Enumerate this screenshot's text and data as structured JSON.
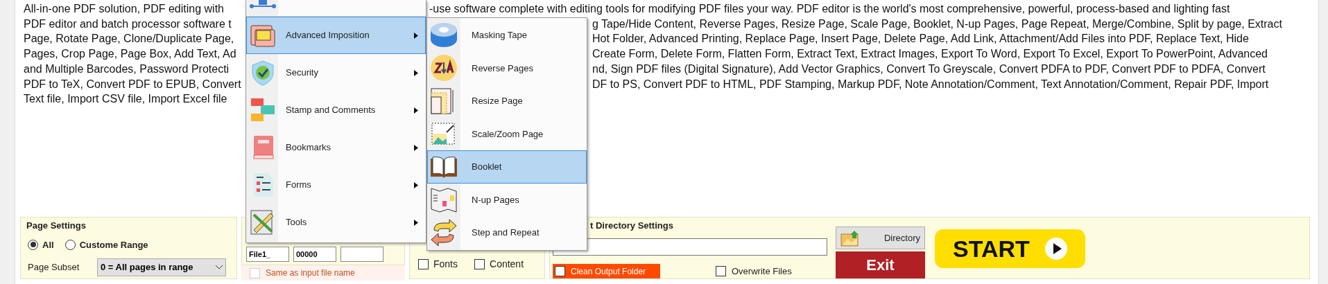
{
  "description_lines": [
    {
      "left": "All-in-one PDF solution, PDF editing with",
      "right": "-use software complete with editing tools for modifying PDF files your way. PDF editor is the world's most comprehensive, powerful, process-based and lighting fast"
    },
    {
      "left": "PDF editor and batch processor software t",
      "right": "g Tape/Hide Content, Reverse Pages, Resize Page, Scale Page, Booklet, N-up Pages, Page Repeat, Merge/Combine, Split by page, Extract"
    },
    {
      "left": "Page, Rotate Page, Clone/Duplicate Page,",
      "right": "Hot Folder, Advanced Printing, Replace Page, Insert Page, Delete Page, Add Link, Attachment/Add Files into PDF, Replace Text, Hide"
    },
    {
      "left": "Pages, Crop Page, Page Box, Add Text, Ad",
      "right": "Create Form, Delete Form, Flatten Form, Extract Text, Extract Images, Export To Word, Export To Excel, Export To PowerPoint, Advanced"
    },
    {
      "left": "and Multiple Barcodes, Password Protecti",
      "right": "nd, Sign PDF files (Digital Signature), Add Vector Graphics, Convert To Greyscale, Convert PDFA to PDF, Convert PDF to PDFA, Convert"
    },
    {
      "left": "PDF to TeX, Convert PDF to EPUB, Convert",
      "right": "DF to PS, Convert PDF to HTML, PDF Stamping, Markup PDF, Note Annotation/Comment, Text Annotation/Comment, Repair PDF, Import"
    },
    {
      "left": "Text file, Import CSV file, Import Excel file"
    }
  ],
  "menu": {
    "items": [
      {
        "kind": "partial"
      },
      {
        "kind": "entry",
        "label": "Advanced Imposition",
        "selected": true
      },
      {
        "kind": "entry",
        "label": "Security",
        "selected": false
      },
      {
        "kind": "entry",
        "label": "Stamp and Comments",
        "selected": false
      },
      {
        "kind": "entry",
        "label": "Bookmarks",
        "selected": false
      },
      {
        "kind": "entry",
        "label": "Forms",
        "selected": false
      },
      {
        "kind": "entry",
        "label": "Tools",
        "selected": false
      }
    ]
  },
  "submenu": {
    "items": [
      {
        "label": "Masking Tape",
        "selected": false
      },
      {
        "label": "Reverse Pages",
        "selected": false
      },
      {
        "label": "Resize Page",
        "selected": false
      },
      {
        "label": "Scale/Zoom Page",
        "selected": false
      },
      {
        "label": "Booklet",
        "selected": true
      },
      {
        "label": "N-up Pages",
        "selected": false
      },
      {
        "label": "Step and Repeat",
        "selected": false
      }
    ]
  },
  "page_settings": {
    "title": "Page Settings",
    "radios": [
      {
        "label": "All",
        "selected": true
      },
      {
        "label": "Custome Range",
        "selected": false
      }
    ],
    "subset_label": "Page Subset",
    "subset_value": "0 = All pages in range"
  },
  "naming": {
    "fields": [
      "File1_",
      "00000"
    ],
    "same_as_input": {
      "label": "Same as input file name",
      "checked": false
    }
  },
  "options": {
    "checkboxes": [
      {
        "label": "Fonts",
        "checked": false
      },
      {
        "label": "Content",
        "checked": false
      }
    ]
  },
  "output": {
    "title": "t Directory Settings",
    "directory_button": "Directory",
    "exit_button": "Exit",
    "clean_output": {
      "label": "Clean Output Folder",
      "checked": false
    },
    "overwrite": {
      "label": "Overwrite Files",
      "checked": false
    },
    "start_button": "START"
  }
}
